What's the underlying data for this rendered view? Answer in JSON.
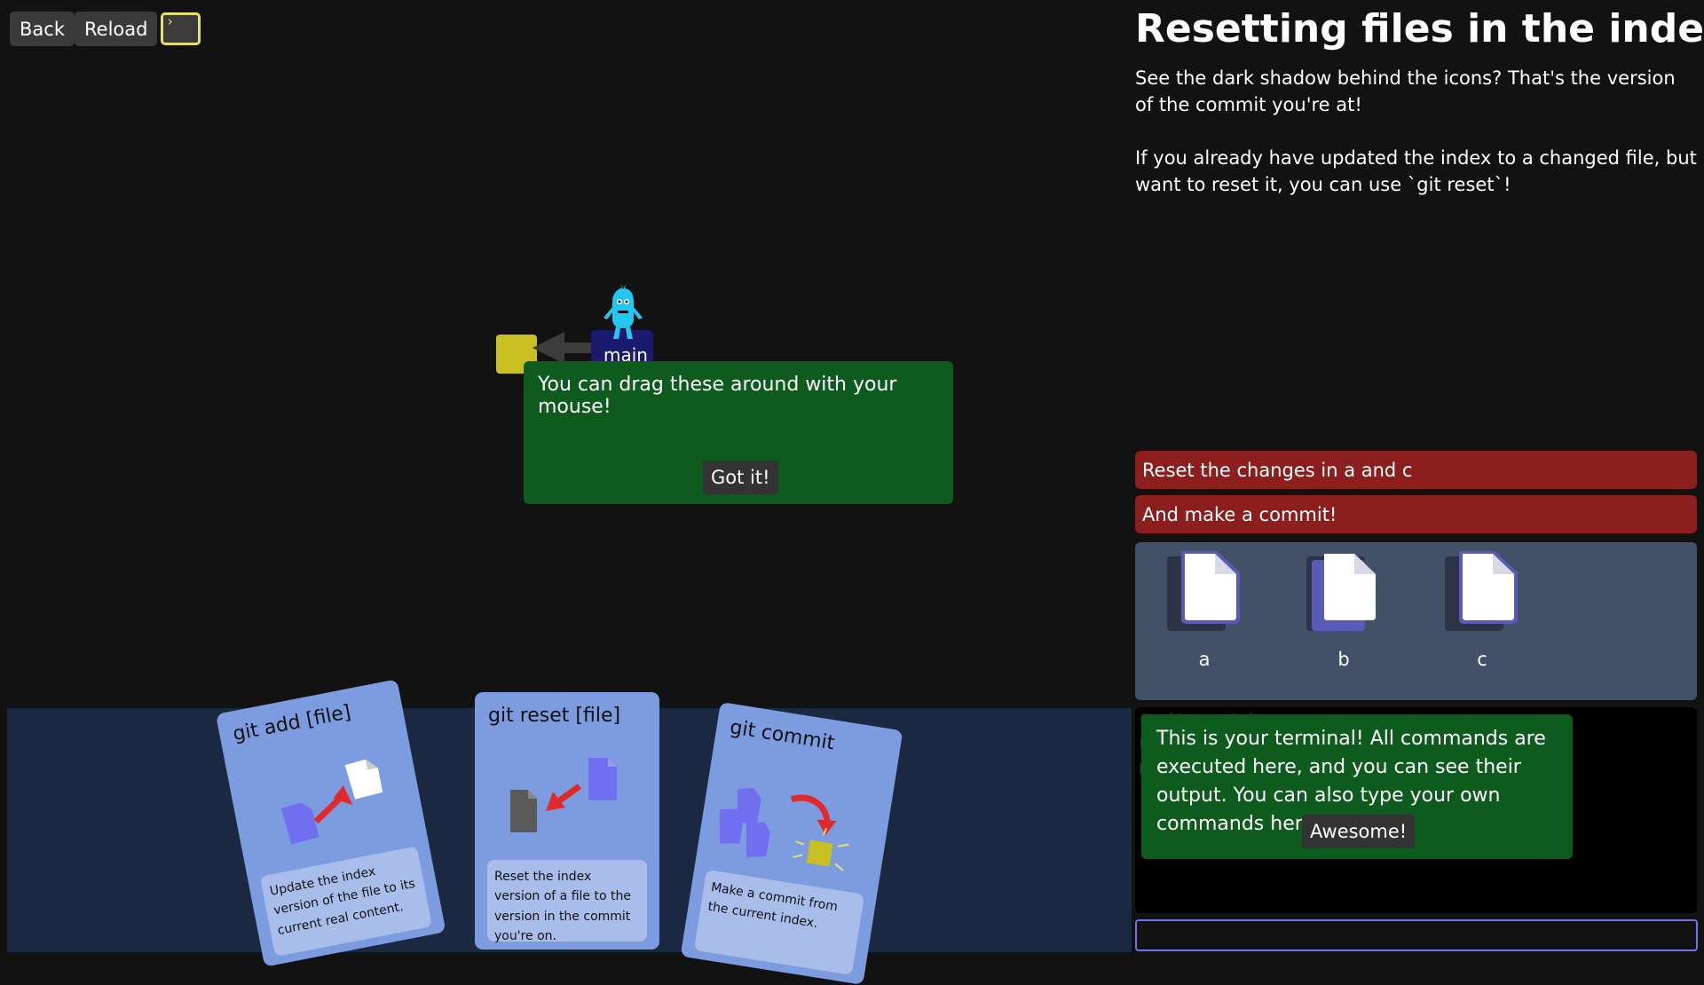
{
  "toolbar": {
    "back_label": "Back",
    "reload_label": "Reload",
    "terminal_glyph": "›"
  },
  "graph": {
    "branch": "main"
  },
  "drag_tip": {
    "text": "You can drag these around with your mouse!",
    "button": "Got it!"
  },
  "cards": [
    {
      "title": "git add [file]",
      "desc": "Update the index version of the file to its current real content."
    },
    {
      "title": "git reset [file]",
      "desc": "Reset the index version of a file to the version in the commit you're on."
    },
    {
      "title": "git commit",
      "desc": "Make a commit from the current index."
    }
  ],
  "level": {
    "title": "Resetting files in the index",
    "para1": "See the dark shadow behind the icons? That's the version of the commit you're at!",
    "para2": "If you already have updated the index to a changed file, but want to reset it, you can use `git reset`!"
  },
  "goals": [
    "Reset the changes in a and c",
    "And make a commit!"
  ],
  "files": [
    "a",
    "b",
    "c"
  ],
  "terminal": {
    "lines": [
      "$ git reset b",
      "Unstaged changes after reset:",
      "M"
    ],
    "tip": "This is your terminal! All commands are executed here, and you can see their output. You can also type your own commands here!",
    "button": "Awesome!"
  },
  "colors": {
    "accent": "#e8e06c",
    "goal": "#8c1e1e",
    "tip": "#0e5b1e",
    "card": "#7d9cdf",
    "file_outline": "#6f6ff0"
  }
}
